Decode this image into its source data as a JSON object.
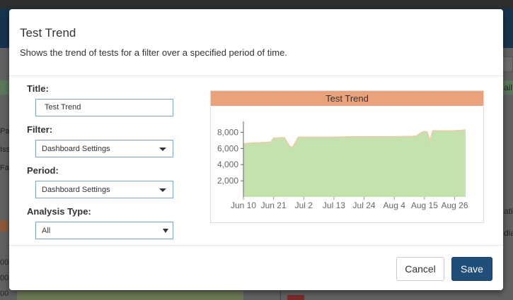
{
  "background": {
    "right_fragments": [
      "ail",
      "atic",
      "dia"
    ],
    "left_fragments": [
      "Pas",
      "Iss",
      "Fa",
      "00",
      "00",
      "00"
    ]
  },
  "modal": {
    "title": "Test Trend",
    "subtitle": "Shows the trend of tests for a filter over a specified period of time.",
    "fields": {
      "title": {
        "label": "Title:",
        "value": "Test Trend"
      },
      "filter": {
        "label": "Filter:",
        "value": "Dashboard Settings"
      },
      "period": {
        "label": "Period:",
        "value": "Dashboard Settings"
      },
      "analysis_type": {
        "label": "Analysis Type:",
        "value": "All"
      }
    },
    "buttons": {
      "cancel": "Cancel",
      "save": "Save"
    }
  },
  "colors": {
    "header_bg": "#17344f",
    "chart_title_bg": "#eaa27b",
    "area_fill": "#c4e2ae",
    "area_line": "#f2c9a4",
    "save_button": "#1f4e78"
  },
  "chart_data": {
    "type": "area",
    "title": "Test Trend",
    "xlabel": "",
    "ylabel": "",
    "ylim": [
      0,
      9000
    ],
    "y_ticks": [
      2000,
      4000,
      6000,
      8000
    ],
    "y_tick_labels": [
      "2,000",
      "4,000",
      "6,000",
      "8,000"
    ],
    "x_tick_labels": [
      "Jun 10",
      "Jun 21",
      "Jul 2",
      "Jul 13",
      "Jul 24",
      "Aug 4",
      "Aug 15",
      "Aug 26"
    ],
    "x": [
      "Jun 10",
      "Jun 12",
      "Jun 14",
      "Jun 16",
      "Jun 17",
      "Jun 18",
      "Jun 20",
      "Jun 21",
      "Jun 22",
      "Jun 24",
      "Jun 25",
      "Jun 27",
      "Jun 28",
      "Jun 30",
      "Jul 2",
      "Jul 7",
      "Jul 13",
      "Jul 18",
      "Jul 24",
      "Jul 30",
      "Aug 4",
      "Aug 8",
      "Aug 10",
      "Aug 12",
      "Aug 14",
      "Aug 15",
      "Aug 16",
      "Aug 17",
      "Aug 18",
      "Aug 26",
      "Aug 30"
    ],
    "values": [
      6600,
      6650,
      6700,
      6700,
      6750,
      6750,
      6800,
      7300,
      7300,
      7350,
      7350,
      6200,
      6200,
      7400,
      7400,
      7400,
      7400,
      7450,
      7450,
      7450,
      7450,
      7500,
      7500,
      7550,
      8000,
      8100,
      8050,
      7000,
      8200,
      8200,
      8300
    ],
    "grid": false,
    "legend": "none"
  }
}
